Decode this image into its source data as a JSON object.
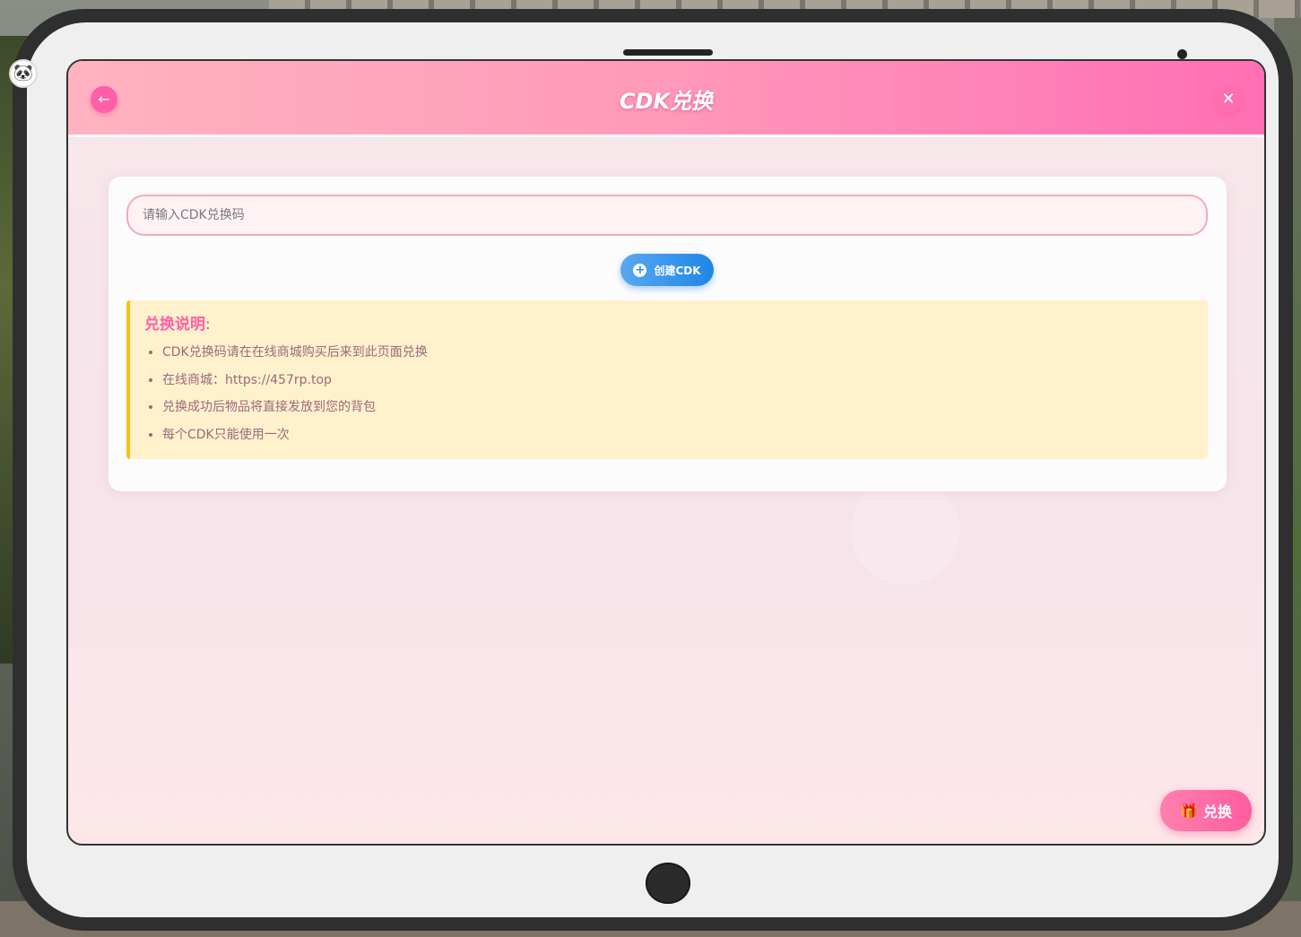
{
  "header": {
    "title": "CDK兑换",
    "back_icon": "←",
    "close_icon": "✕"
  },
  "form": {
    "cdk_input": {
      "value": "",
      "placeholder": "请输入CDK兑换码"
    },
    "create_button_label": "创建CDK",
    "create_button_icon": "+"
  },
  "instructions": {
    "title": "兑换说明",
    "title_suffix": ":",
    "items": [
      "CDK兑换码请在在线商城购买后来到此页面兑换",
      "在线商城：https://457rp.top",
      "兑换成功后物品将直接发放到您的背包",
      "每个CDK只能使用一次"
    ]
  },
  "footer": {
    "redeem_button_label": "兑换",
    "redeem_button_icon": "🎁"
  },
  "colors": {
    "accent_pink": "#ff5fa8",
    "header_gradient_start": "#ffb3c1",
    "header_gradient_end": "#ff6fb5",
    "create_blue": "#1f86e6",
    "info_bg": "#fff1cc",
    "info_border": "#f8c012"
  }
}
